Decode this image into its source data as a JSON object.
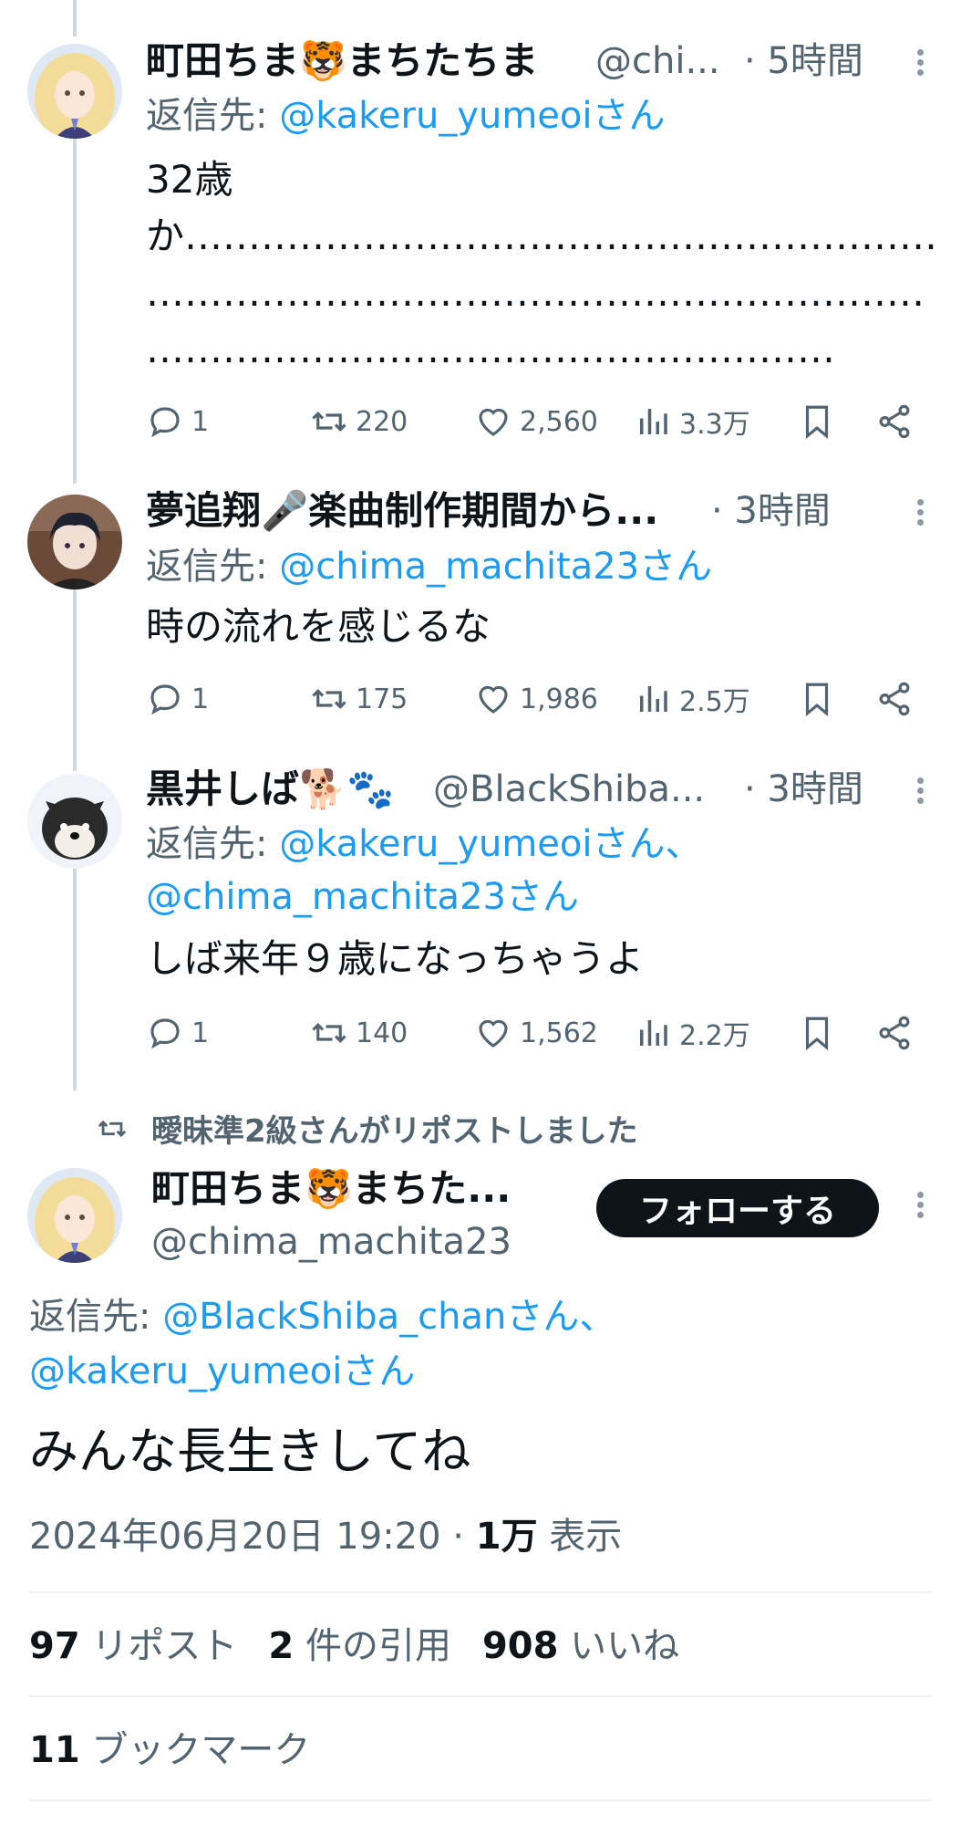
{
  "tweets": [
    {
      "name": "町田ちま🐯まちたちま",
      "handle": "@chi...",
      "time": "· 5時間",
      "reply_prefix": "返信先: ",
      "reply_to_line1": "@kakeru_yumeoiさん",
      "reply_to_line2": "",
      "text_line1": "32歳",
      "text_line2": "か……………………………………………………",
      "text_line3": "………………………………………………………………",
      "text_line4": "………………………………………………",
      "replies": "1",
      "reposts": "220",
      "likes": "2,560",
      "views": "3.3万"
    },
    {
      "name": "夢追翔🎤楽曲制作期間から...",
      "handle": "",
      "time": "· 3時間",
      "reply_prefix": "返信先: ",
      "reply_to_line1": "@chima_machita23さん",
      "reply_to_line2": "",
      "text_line1": "時の流れを感じるな",
      "replies": "1",
      "reposts": "175",
      "likes": "1,986",
      "views": "2.5万"
    },
    {
      "name": "黒井しば🐕🐾",
      "handle": "@BlackShiba...",
      "time": "· 3時間",
      "reply_prefix": "返信先: ",
      "reply_to_line1": "@kakeru_yumeoiさん、",
      "reply_to_line2": "@chima_machita23さん",
      "text_line1": "しば来年９歳になっちゃうよ",
      "replies": "1",
      "reposts": "140",
      "likes": "1,562",
      "views": "2.2万"
    }
  ],
  "main": {
    "repost_context": "曖昧準2級さんがリポストしました",
    "name": "町田ちま🐯まちた...",
    "handle": "@chima_machita23",
    "follow_label": "フォローする",
    "reply_prefix": "返信先: ",
    "reply_to_line1": "@BlackShiba_chanさん、",
    "reply_to_line2": "@kakeru_yumeoiさん",
    "text": "みんな長生きしてね",
    "datetime": "2024年06月20日 19:20 · ",
    "views_count": "1万",
    "views_label": " 表示",
    "reposts_count": "97",
    "reposts_label": " リポスト",
    "quotes_count": "2",
    "quotes_label": " 件の引用",
    "likes_count": "908",
    "likes_label": " いいね",
    "bookmarks_count": "11",
    "bookmarks_label": " ブックマーク"
  },
  "colors": {
    "link": "#1d9bf0",
    "muted": "#536471",
    "text": "#0f1419",
    "thread_line": "#cfd9de"
  }
}
